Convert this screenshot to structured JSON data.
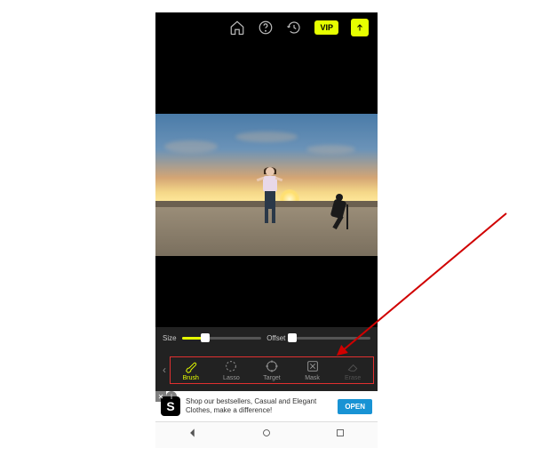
{
  "topbar": {
    "vip_label": "VIP"
  },
  "sliders": {
    "size_label": "Size",
    "offset_label": "Offset",
    "size_value": 30,
    "offset_value": 2
  },
  "tools": {
    "items": [
      {
        "key": "brush",
        "label": "Brush"
      },
      {
        "key": "lasso",
        "label": "Lasso"
      },
      {
        "key": "target",
        "label": "Target"
      },
      {
        "key": "mask",
        "label": "Mask"
      },
      {
        "key": "erase",
        "label": "Erase"
      }
    ]
  },
  "ad": {
    "icon_letter": "S",
    "text": "Shop our bestsellers, Casual and Elegant Clothes, make a difference!",
    "cta": "OPEN"
  }
}
